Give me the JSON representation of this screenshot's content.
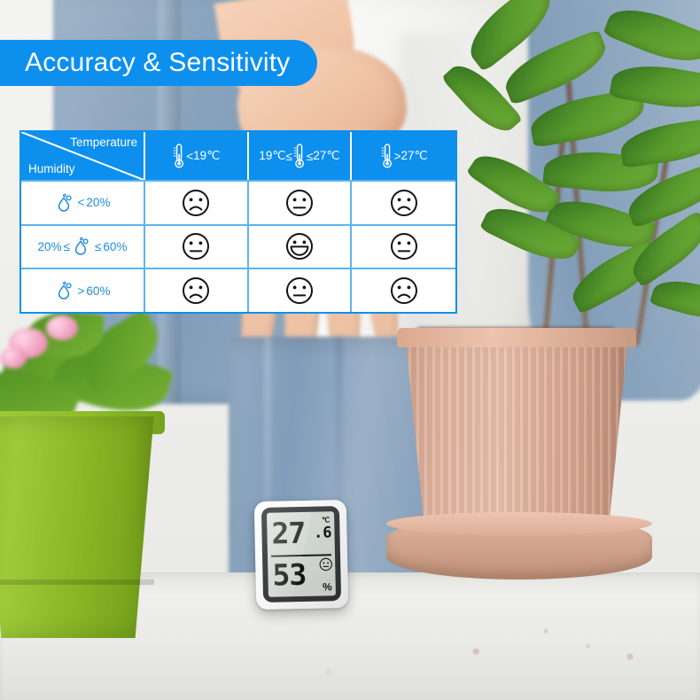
{
  "banner": {
    "title": "Accuracy & Sensitivity",
    "accent_color": "#0D8FEE"
  },
  "comfort_table": {
    "corner": {
      "column_axis_label": "Temperature",
      "row_axis_label": "Humidity"
    },
    "temperature_columns": [
      {
        "id": "cold",
        "icon": "thermometer-icon",
        "prefix": "",
        "operator_left": "",
        "operator_right": "<",
        "value": "19℃"
      },
      {
        "id": "ideal",
        "icon": "thermometer-icon",
        "prefix": "19℃",
        "operator_left": "≤",
        "operator_right": "≤",
        "value": "27℃"
      },
      {
        "id": "hot",
        "icon": "thermometer-icon",
        "prefix": "",
        "operator_left": "",
        "operator_right": ">",
        "value": "27℃"
      }
    ],
    "humidity_rows": [
      {
        "id": "dry",
        "icon": "humidity-drop-icon",
        "prefix": "",
        "operator_left": "",
        "operator_right": "<",
        "value": "20%"
      },
      {
        "id": "ideal",
        "icon": "humidity-drop-icon",
        "prefix": "20%",
        "operator_left": "≤",
        "operator_right": "≤",
        "value": "60%"
      },
      {
        "id": "humid",
        "icon": "humidity-drop-icon",
        "prefix": "",
        "operator_left": "",
        "operator_right": ">",
        "value": "60%"
      }
    ],
    "cells": [
      [
        "sad",
        "neutral",
        "sad"
      ],
      [
        "neutral",
        "happy",
        "neutral"
      ],
      [
        "sad",
        "neutral",
        "sad"
      ]
    ],
    "border_color": "#5CB4F0",
    "header_color": "#0D8FEE",
    "label_text_color": "#1E8CE0"
  },
  "device": {
    "name": "indoor-thermo-hygrometer",
    "temperature_integer": "27",
    "temperature_decimal": ".6",
    "temperature_unit": "℃",
    "humidity_value": "53",
    "humidity_unit": "%",
    "comfort_face": "neutral"
  }
}
